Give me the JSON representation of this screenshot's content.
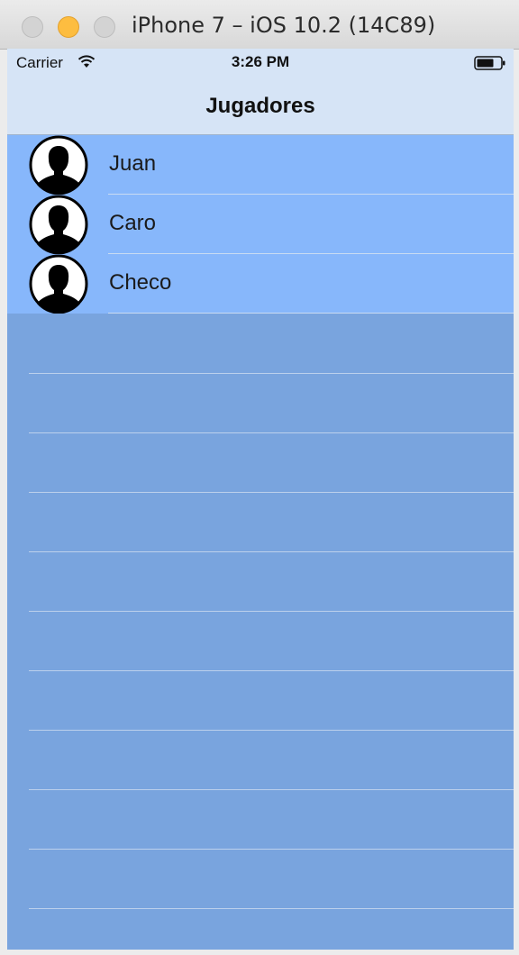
{
  "window": {
    "title": "iPhone 7 – iOS 10.2 (14C89)"
  },
  "status_bar": {
    "carrier": "Carrier",
    "time": "3:26 PM",
    "wifi_icon": "wifi-icon",
    "battery_icon": "battery-icon"
  },
  "nav_bar": {
    "title": "Jugadores"
  },
  "players": [
    {
      "name": "Juan",
      "icon": "person-silhouette-icon"
    },
    {
      "name": "Caro",
      "icon": "person-silhouette-icon"
    },
    {
      "name": "Checo",
      "icon": "person-silhouette-icon"
    }
  ],
  "colors": {
    "screen_background": "#79a4de",
    "row_background": "#87b7fb",
    "bar_background": "#d6e4f6",
    "minimize_button": "#fdbd40"
  }
}
